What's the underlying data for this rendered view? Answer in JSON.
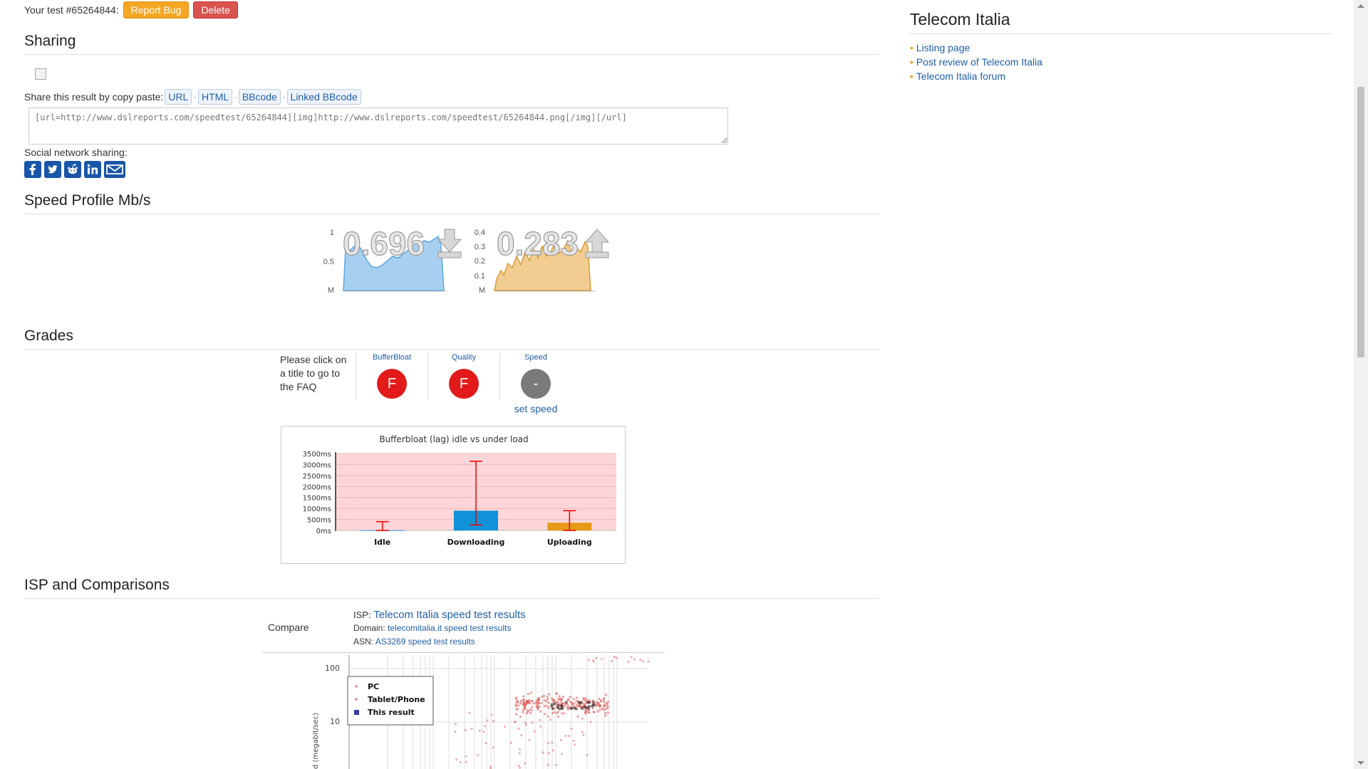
{
  "header": {
    "test_label": "Your test #65264844:",
    "report_bug_label": "Report Bug",
    "delete_label": "Delete"
  },
  "sharing": {
    "title": "Sharing",
    "share_text": "Share this result by copy paste:",
    "formats": [
      "URL",
      "HTML",
      "BBcode",
      "Linked BBcode"
    ],
    "textarea_value": "[url=http://www.dslreports.com/speedtest/65264844][img]http://www.dslreports.com/speedtest/65264844.png[/img][/url]",
    "social_label": "Social network sharing:",
    "social_icons": [
      "facebook-icon",
      "twitter-icon",
      "reddit-icon",
      "linkedin-icon",
      "email-icon"
    ]
  },
  "speed_profile": {
    "title": "Speed Profile Mb/s",
    "download_value": "0.696",
    "upload_value": "0.283",
    "download_ticks": [
      "1",
      "0.5",
      "M"
    ],
    "upload_ticks": [
      "0.4",
      "0.3",
      "0.2",
      "0.1",
      "M"
    ],
    "download_color": "#7ab8e6",
    "upload_color": "#e8b15f"
  },
  "grades": {
    "title": "Grades",
    "hint": "Please click on a title to go to the FAQ",
    "items": [
      {
        "label": "BufferBloat",
        "grade": "F",
        "color": "#e21a1a"
      },
      {
        "label": "Quality",
        "grade": "F",
        "color": "#e21a1a"
      },
      {
        "label": "Speed",
        "grade": "-",
        "color": "#7a7a7a"
      }
    ],
    "set_speed_label": "set speed"
  },
  "chart_data": [
    {
      "type": "bar",
      "title": "Bufferbloat (lag) idle vs under load",
      "categories": [
        "Idle",
        "Downloading",
        "Uploading"
      ],
      "values": [
        10,
        900,
        350
      ],
      "error_low": [
        0,
        250,
        0
      ],
      "error_high": [
        400,
        3150,
        900
      ],
      "colors": [
        "#3399ee",
        "#1192d8",
        "#e69a16"
      ],
      "yticks": [
        "0ms",
        "500ms",
        "1000ms",
        "1500ms",
        "2000ms",
        "2500ms",
        "3000ms",
        "3500ms"
      ],
      "ylim": [
        0,
        3500
      ]
    }
  ],
  "isp": {
    "title": "ISP and Comparisons",
    "compare_label": "Compare",
    "isp_prefix": "ISP:",
    "isp_link": "Telecom Italia speed test results",
    "domain_prefix": "Domain:",
    "domain_link": "telecomitalia.it speed test results",
    "asn_prefix": "ASN:",
    "asn_link": "AS3269 speed test results",
    "scatter_yticks": [
      "100",
      "10"
    ],
    "scatter_ylabel": "d (megabit/sec)",
    "legend": [
      "PC",
      "Tablet/Phone",
      "This result"
    ]
  },
  "sidebar": {
    "title": "Telecom Italia",
    "links": [
      "Listing page",
      "Post review of Telecom Italia",
      "Telecom Italia forum"
    ]
  }
}
